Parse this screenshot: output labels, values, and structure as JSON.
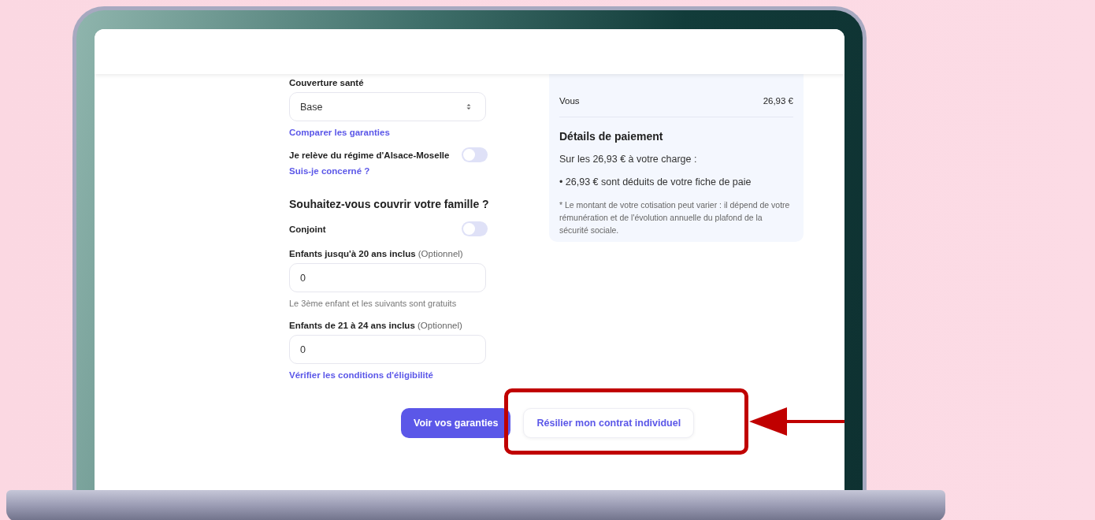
{
  "form": {
    "coverage_label": "Couverture santé",
    "coverage_select": {
      "value": "Base"
    },
    "compare_link": "Comparer les garanties",
    "alsace_toggle": {
      "label": "Je relève du régime d'Alsace-Moselle",
      "on": false
    },
    "concerned_link": "Suis-je concerné ?",
    "family_heading": "Souhaitez-vous couvrir votre famille ?",
    "spouse_toggle": {
      "label": "Conjoint",
      "on": false
    },
    "children_fields": [
      {
        "label": "Enfants jusqu'à 20 ans inclus",
        "optional": "(Optionnel)",
        "value": "0",
        "hint": "Le 3ème enfant et les suivants sont gratuits"
      },
      {
        "label": "Enfants de 21 à 24 ans inclus",
        "optional": "(Optionnel)",
        "value": "0",
        "link": "Vérifier les conditions d'éligibilité"
      }
    ]
  },
  "summary": {
    "rows": [
      {
        "label": "Vous",
        "amount": "26,93 €"
      }
    ],
    "payment_heading": "Détails de paiement",
    "payment_intro": "Sur les 26,93 € à votre charge :",
    "payment_items": [
      "• 26,93 € sont déduits de votre fiche de paie"
    ],
    "footnote": "* Le montant de votre cotisation peut varier : il dépend de votre rémunération et de l'évolution annuelle du plafond de la sécurité sociale."
  },
  "actions": [
    {
      "label": "Voir vos garanties",
      "kind": "primary",
      "highlighted": false
    },
    {
      "label": "Résilier mon contrat individuel",
      "kind": "secondary",
      "highlighted": true
    }
  ]
}
